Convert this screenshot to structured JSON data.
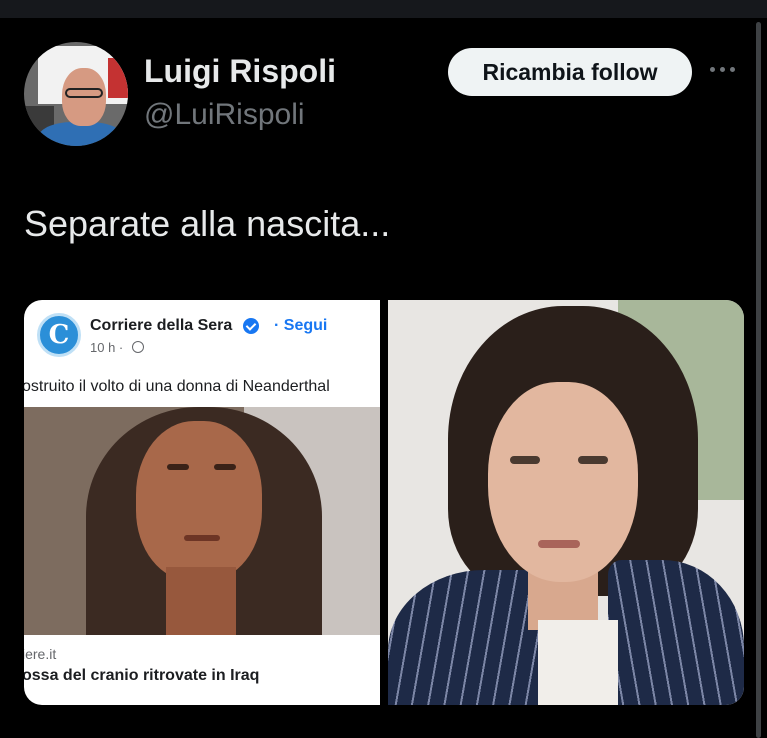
{
  "tweet": {
    "author": {
      "display_name": "Luigi Rispoli",
      "handle": "@LuiRispoli"
    },
    "follow_button": "Ricambia follow",
    "more_icon": "ellipsis-horizontal-icon",
    "text": "Separate alla nascita...",
    "media": {
      "left": {
        "page_name": "Corriere della Sera",
        "follow_label": "· Segui",
        "time": "10 h ·",
        "caption": "ostruito il volto di una donna di Neanderthal",
        "link_domain": "iere.it",
        "link_title": "ossa del cranio ritrovate in Iraq",
        "logo_letter": "C"
      }
    }
  },
  "colors": {
    "background": "#000000",
    "follow_button_bg": "#eff3f4",
    "facebook_blue": "#1877f2"
  }
}
